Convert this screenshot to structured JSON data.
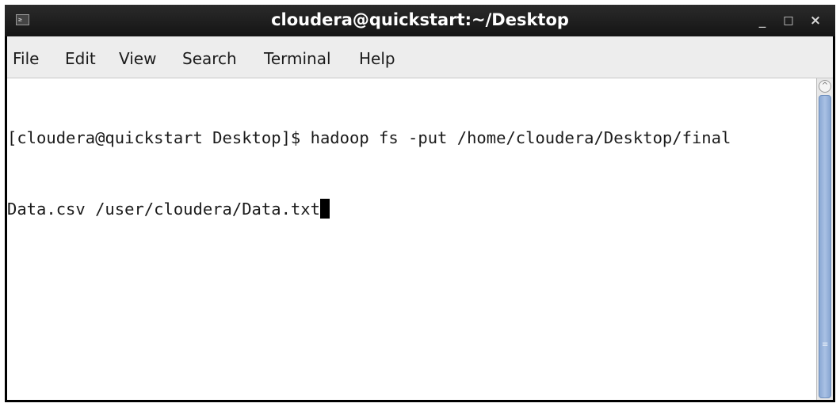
{
  "window": {
    "title": "cloudera@quickstart:~/Desktop",
    "minimize_glyph": "_",
    "maximize_glyph": "□",
    "close_glyph": "×",
    "terminal_icon_glyph": "≥"
  },
  "menu": {
    "items": [
      "File",
      "Edit",
      "View",
      "Search",
      "Terminal",
      "Help"
    ]
  },
  "terminal": {
    "lines": [
      "[cloudera@quickstart Desktop]$ hadoop fs -put /home/cloudera/Desktop/final",
      "Data.csv /user/cloudera/Data.txt"
    ]
  },
  "scrollbar": {
    "up_glyph": "^",
    "grip_glyph": "≡"
  },
  "colors": {
    "titlebar": "#1f1f1f",
    "menubar": "#ededed",
    "terminal_bg": "#ffffff",
    "terminal_fg": "#1a1a1a",
    "scroll_thumb": "#a9c1e4"
  }
}
